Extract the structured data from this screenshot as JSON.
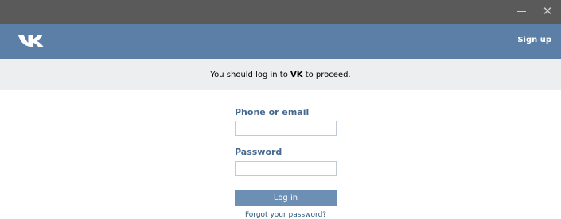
{
  "window": {
    "minimize_icon": "minimize-icon",
    "close_icon": "close-icon",
    "close_glyph": "✕"
  },
  "header": {
    "logo": "VK",
    "signup_label": "Sign up",
    "bg_color": "#5b7fa6"
  },
  "notice": {
    "text_before": "You should log in to ",
    "brand": "VK",
    "text_after": " to proceed."
  },
  "form": {
    "login_label": "Phone or email",
    "login_value": "",
    "password_label": "Password",
    "password_value": "",
    "submit_label": "Log in",
    "forgot_label": "Forgot your password?"
  },
  "colors": {
    "accent": "#5b7fa6",
    "label": "#45688e",
    "button": "#6d8fb3",
    "link": "#2b587a"
  }
}
